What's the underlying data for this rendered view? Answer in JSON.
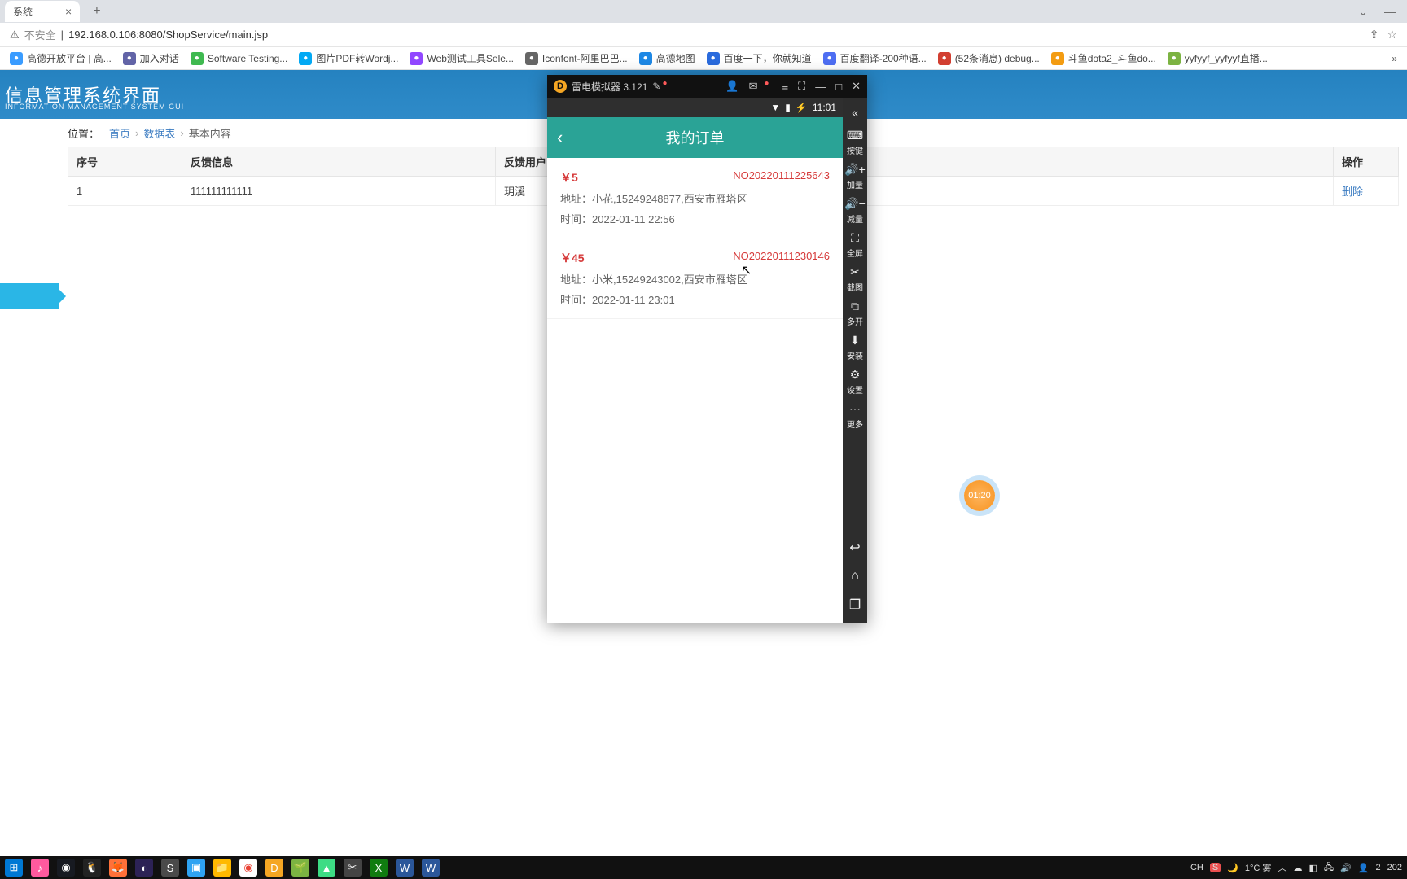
{
  "browser": {
    "tab_title": "系统",
    "url_prefix": "不安全",
    "url": "192.168.0.106:8080/ShopService/main.jsp"
  },
  "bookmarks": [
    {
      "label": "高德开放平台 | 高...",
      "color": "#3a9cff"
    },
    {
      "label": "加入对话",
      "color": "#6264a7"
    },
    {
      "label": "Software Testing...",
      "color": "#3fb950"
    },
    {
      "label": "图片PDF转Wordj...",
      "color": "#03a9f4"
    },
    {
      "label": "Web测试工具Sele...",
      "color": "#9147ff"
    },
    {
      "label": "Iconfont-阿里巴巴...",
      "color": "#666"
    },
    {
      "label": "高德地图",
      "color": "#1e88e5"
    },
    {
      "label": "百度一下，你就知道",
      "color": "#2a6bdd"
    },
    {
      "label": "百度翻译-200种语...",
      "color": "#4e6ef2"
    },
    {
      "label": "(52条消息) debug...",
      "color": "#d23f31"
    },
    {
      "label": "斗鱼dota2_斗鱼do...",
      "color": "#f39c12"
    },
    {
      "label": "yyfyyf_yyfyyf直播...",
      "color": "#7cb342"
    }
  ],
  "banner": {
    "title": "信息管理系统界面",
    "subtitle": "INFORMATION MANAGEMENT SYSTEM GUI"
  },
  "breadcrumb": {
    "label": "位置：",
    "items": [
      "首页",
      "数据表"
    ],
    "current": "基本内容"
  },
  "table": {
    "headers": [
      "序号",
      "反馈信息",
      "反馈用户",
      "操作"
    ],
    "rows": [
      {
        "no": "1",
        "msg": "111111111111",
        "user": "玥溪",
        "op": "删除"
      }
    ]
  },
  "emulator": {
    "title": "雷电模拟器 3.121",
    "status_time": "11:01",
    "app_title": "我的订单",
    "orders": [
      {
        "price": "￥5",
        "no": "NO20220111225643",
        "addr": "地址：小花,15249248877,西安市雁塔区",
        "time": "时间：2022-01-11 22:56"
      },
      {
        "price": "￥45",
        "no": "NO20220111230146",
        "addr": "地址：小米,15249243002,西安市雁塔区",
        "time": "时间：2022-01-11 23:01"
      }
    ],
    "sidebar": [
      {
        "icon": "⌨",
        "label": "按键"
      },
      {
        "icon": "🔊+",
        "label": "加量"
      },
      {
        "icon": "🔊−",
        "label": "减量"
      },
      {
        "icon": "⛶",
        "label": "全屏"
      },
      {
        "icon": "✂",
        "label": "截图"
      },
      {
        "icon": "⧉",
        "label": "多开"
      },
      {
        "icon": "⬇",
        "label": "安装"
      },
      {
        "icon": "⚙",
        "label": "设置"
      },
      {
        "icon": "⋯",
        "label": "更多"
      }
    ]
  },
  "timer": {
    "value": "01:20"
  },
  "taskbar": {
    "weather": "1°C 雾",
    "ime": "CH",
    "time": "2",
    "date": "202"
  }
}
